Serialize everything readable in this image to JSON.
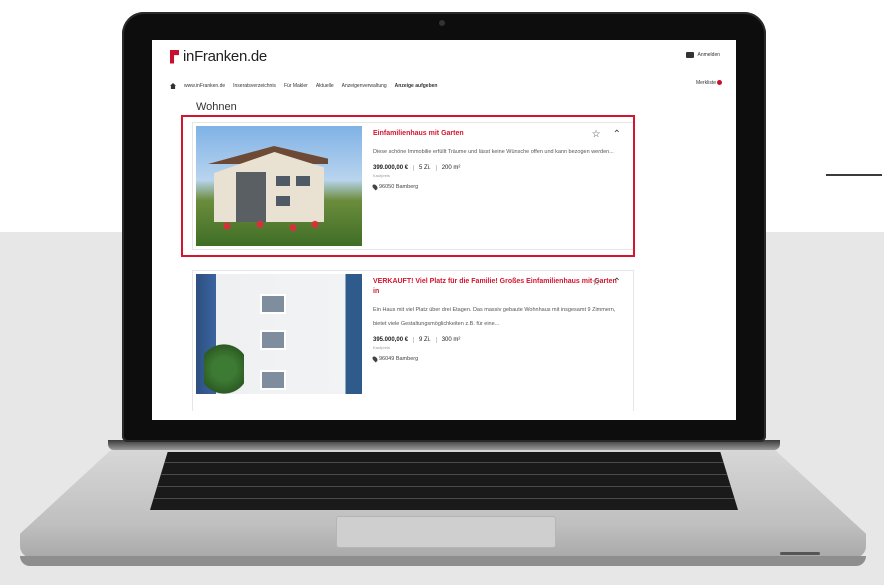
{
  "site": {
    "logo_text": "inFranken.de",
    "login_label": "Anmelden",
    "brand_color": "#d4152e"
  },
  "nav": {
    "items": [
      "www.inFranken.de",
      "Inseratsverzeichnis",
      "Für Makler",
      "Aktuelle",
      "Anzeigenverwaltung",
      "Anzeige aufgeben"
    ],
    "merkliste_label": "Merkliste"
  },
  "section_title": "Wohnen",
  "listings": [
    {
      "title": "Einfamilienhaus mit Garten",
      "description": "Diese schöne Immobilie erfüllt Träume und lässt keine Wünsche offen und kann bezogen werden...",
      "price": "399.000,00 €",
      "rooms": "5 Zi.",
      "area": "200 m²",
      "price_type": "Kaufpreis",
      "location": "96050 Bamberg",
      "highlighted": true
    },
    {
      "title": "VERKAUFT! Viel Platz für die Familie! Großes Einfamilienhaus mit Garten in",
      "description": "Ein Haus mit viel Platz über drei Etagen. Das massiv gebaute Wohnhaus mit insgesamt 9 Zimmern, bietet viele Gestaltungsmöglichkeiten z.B. für eine...",
      "price": "395.000,00 €",
      "rooms": "9 Zi.",
      "area": "300 m²",
      "price_type": "Kaufpreis",
      "location": "96049 Bamberg",
      "highlighted": false
    }
  ]
}
